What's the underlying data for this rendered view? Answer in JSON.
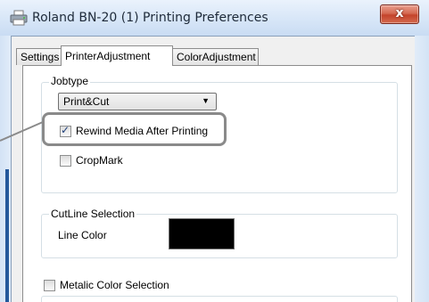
{
  "window": {
    "title": "Roland BN-20 (1) Printing Preferences",
    "close_glyph": "x",
    "app_icon": "printer-icon"
  },
  "tabs": [
    {
      "label": "Settings",
      "active": false
    },
    {
      "label": "PrinterAdjustment",
      "active": true
    },
    {
      "label": "ColorAdjustment",
      "active": false
    }
  ],
  "jobtype": {
    "group_label": "Jobtype",
    "selected": "Print&Cut",
    "dropdown_icon": "triangle-down-icon"
  },
  "options": {
    "rewind": {
      "label": "Rewind Media After Printing",
      "checked": true
    },
    "cropmark": {
      "label": "CropMark",
      "checked": false
    }
  },
  "cutline": {
    "group_label": "CutLine Selection",
    "line_color_label": "Line Color",
    "line_color_value": "#000000"
  },
  "metallic": {
    "label": "Metalic Color Selection",
    "checked": false
  },
  "colors": {
    "title_bar": "#d9e7f8",
    "close_button": "#c4432b",
    "callout_border": "#8a8a8a",
    "frame_accent": "#24589b"
  }
}
